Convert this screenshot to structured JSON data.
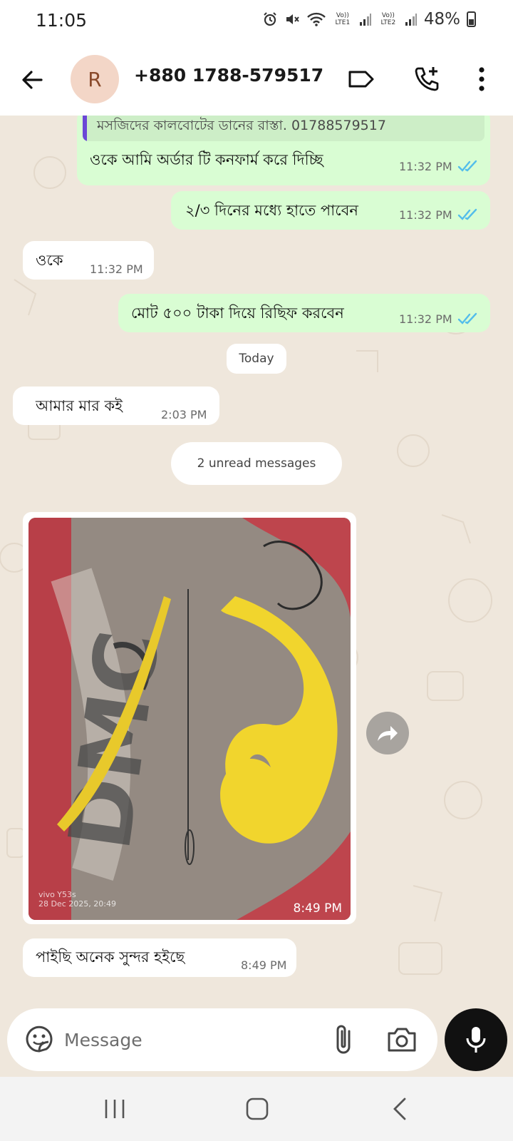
{
  "status_bar": {
    "time": "11:05",
    "sim1_label": "Vo)) LTE1",
    "sim2_label": "Vo)) LTE2",
    "battery": "48%"
  },
  "header": {
    "avatar_initial": "R",
    "contact": "+880 1788-579517"
  },
  "messages": [
    {
      "type": "outgoing",
      "quote": "মসজিদের কালবোটের ডানের রাস্তা.  01788579517",
      "text": "ওকে আমি অর্ডার টি কনফার্ম করে দিচ্ছি",
      "time": "11:32 PM",
      "read": true
    },
    {
      "type": "outgoing",
      "text": "২/৩ দিনের মধ্যে হাতে পাবেন",
      "time": "11:32 PM",
      "read": true
    },
    {
      "type": "incoming",
      "text": "ওকে",
      "time": "11:32 PM"
    },
    {
      "type": "outgoing",
      "text": "মোট ৫০০ টাকা দিয়ে রিছিফ করবেন",
      "time": "11:32 PM",
      "read": true
    },
    {
      "type": "date_chip",
      "text": "Today"
    },
    {
      "type": "incoming",
      "text": "আমার মার কই",
      "time": "2:03 PM"
    },
    {
      "type": "unread_chip",
      "text": "2 unread messages"
    },
    {
      "type": "incoming_image",
      "time": "8:49 PM",
      "watermark_line1": "vivo Y53s",
      "watermark_line2": "28 Dec 2025, 20:49"
    },
    {
      "type": "incoming",
      "text": "পাইছি অনেক সুন্দর হইছে",
      "time": "8:49 PM"
    }
  ],
  "composer": {
    "placeholder": "Message"
  },
  "icons": {
    "back": "arrow-left-icon",
    "label": "label-icon",
    "add_call": "add-call-icon",
    "menu": "more-vert-icon",
    "forward": "forward-icon",
    "sticker": "sticker-icon",
    "attach": "paperclip-icon",
    "camera": "camera-icon",
    "mic": "mic-icon"
  },
  "colors": {
    "outgoing_bubble": "#d9fdd3",
    "incoming_bubble": "#ffffff",
    "read_ticks": "#53bdeb",
    "quote_bar": "#6b47d6",
    "chat_background": "#efe7dc"
  }
}
